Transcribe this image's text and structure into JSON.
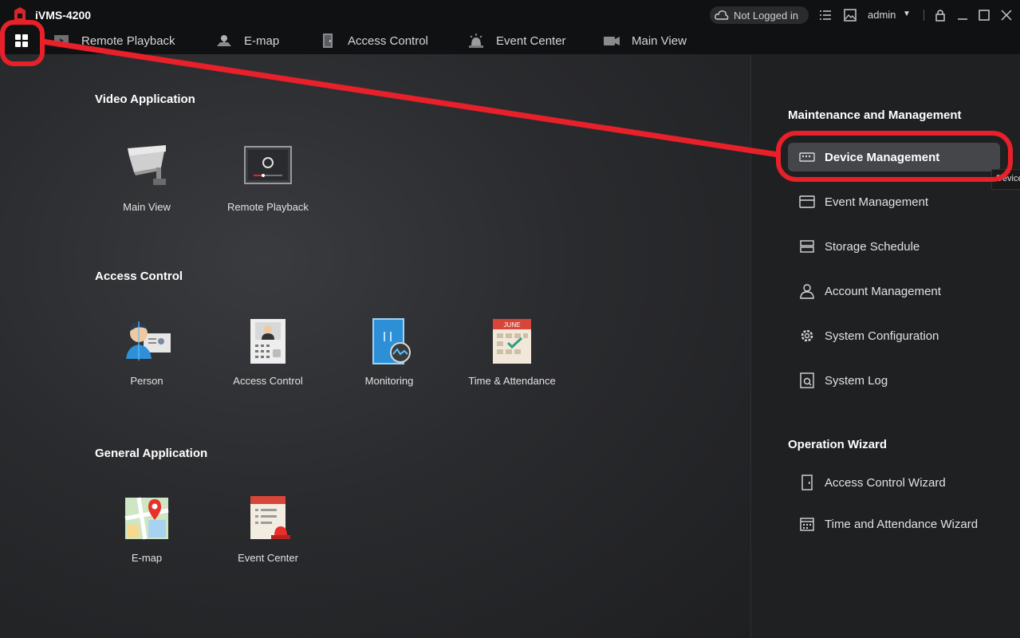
{
  "app": {
    "title": "iVMS-4200"
  },
  "titlebar": {
    "status": "Not Logged in",
    "user": "admin",
    "icons": [
      "cloud-icon",
      "list-icon",
      "image-icon",
      "caret-down-icon",
      "lock-icon",
      "minimize-icon",
      "maximize-icon",
      "close-icon"
    ]
  },
  "nav": {
    "tabs": [
      {
        "label": "Remote Playback",
        "icon": "playback-icon"
      },
      {
        "label": "E-map",
        "icon": "map-icon"
      },
      {
        "label": "Access Control",
        "icon": "door-icon"
      },
      {
        "label": "Event Center",
        "icon": "alarm-icon"
      },
      {
        "label": "Main View",
        "icon": "camera-icon"
      }
    ]
  },
  "sections": {
    "video": {
      "title": "Video Application",
      "apps": [
        {
          "label": "Main View",
          "icon": "cctv-camera-icon"
        },
        {
          "label": "Remote Playback",
          "icon": "playback-screen-icon"
        }
      ]
    },
    "access": {
      "title": "Access Control",
      "apps": [
        {
          "label": "Person",
          "icon": "person-card-icon"
        },
        {
          "label": "Access Control",
          "icon": "door-station-icon"
        },
        {
          "label": "Monitoring",
          "icon": "door-monitor-icon"
        },
        {
          "label": "Time & Attendance",
          "icon": "calendar-icon",
          "badge": "JUNE"
        }
      ]
    },
    "general": {
      "title": "General Application",
      "apps": [
        {
          "label": "E-map",
          "icon": "map-pin-icon"
        },
        {
          "label": "Event Center",
          "icon": "event-alarm-icon"
        }
      ]
    }
  },
  "right_panel": {
    "maintenance_title": "Maintenance and Management",
    "maintenance_items": [
      {
        "label": "Device Management",
        "icon": "device-icon",
        "active": true
      },
      {
        "label": "Event Management",
        "icon": "event-icon"
      },
      {
        "label": "Storage Schedule",
        "icon": "storage-icon"
      },
      {
        "label": "Account Management",
        "icon": "user-icon"
      },
      {
        "label": "System Configuration",
        "icon": "gear-icon"
      },
      {
        "label": "System Log",
        "icon": "log-icon"
      }
    ],
    "wizard_title": "Operation Wizard",
    "wizard_items": [
      {
        "label": "Access Control Wizard",
        "icon": "door-icon"
      },
      {
        "label": "Time and Attendance Wizard",
        "icon": "calendar-grid-icon"
      }
    ],
    "tooltip": "Device"
  },
  "colors": {
    "annotation": "#e8202a",
    "active_item": "#45464a",
    "brand": "#e1252b"
  }
}
